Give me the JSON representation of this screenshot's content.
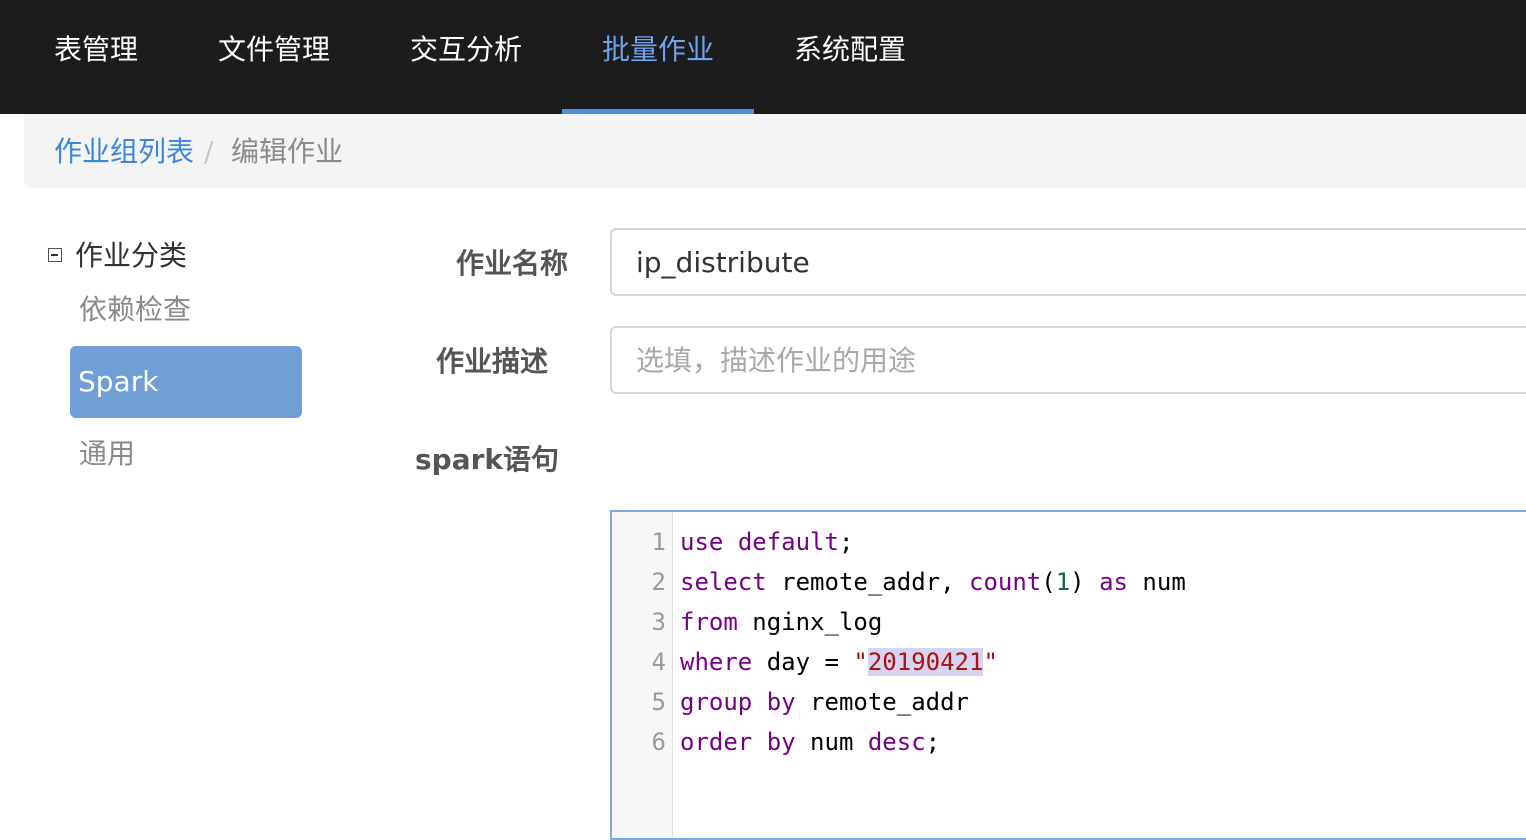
{
  "nav": {
    "items": [
      {
        "label": "表管理"
      },
      {
        "label": "文件管理"
      },
      {
        "label": "交互分析"
      },
      {
        "label": "批量作业"
      },
      {
        "label": "系统配置"
      }
    ],
    "active_index": 3
  },
  "breadcrumb": {
    "parent": "作业组列表",
    "separator": "/",
    "current": "编辑作业"
  },
  "tree": {
    "root_label": "作业分类",
    "items": [
      {
        "label": "依赖检查"
      },
      {
        "label": "Spark"
      },
      {
        "label": "通用"
      }
    ],
    "selected_index": 1
  },
  "form": {
    "name_label": "作业名称",
    "name_value": "ip_distribute",
    "desc_label": "作业描述",
    "desc_placeholder": "选填，描述作业的用途",
    "sql_label": "spark语句"
  },
  "editor": {
    "line_numbers": [
      "1",
      "2",
      "3",
      "4",
      "5",
      "6"
    ],
    "lines": [
      "use default;",
      "select remote_addr, count(1) as num",
      "from nginx_log",
      "where day = \"20190421\"",
      "group by remote_addr",
      "order by num desc;"
    ]
  },
  "colors": {
    "nav_bg": "#1c1c1c",
    "nav_active": "#6ea3f0",
    "link": "#3a86e0",
    "selected_bg": "#6f9fd4",
    "keyword": "#770088",
    "string": "#aa1111",
    "number": "#116644"
  }
}
